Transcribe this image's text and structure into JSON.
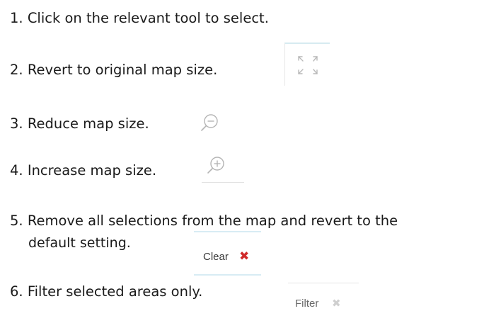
{
  "steps": [
    {
      "number": "1.",
      "text": "Click on the relevant tool to select."
    },
    {
      "number": "2.",
      "text": "Revert to original map size."
    },
    {
      "number": "3.",
      "text": "Reduce map size."
    },
    {
      "number": "4.",
      "text": "Increase map size."
    },
    {
      "number": "5.",
      "text_line1": "Remove all selections from the map and revert to the",
      "text_line2": "default setting."
    },
    {
      "number": "6.",
      "text": "Filter selected areas only."
    }
  ],
  "tools": {
    "revert_icon": "fullscreen-arrows-icon",
    "zoom_out_icon": "zoom-out-icon",
    "zoom_in_icon": "zoom-in-icon",
    "clear_label": "Clear",
    "clear_icon": "close-icon",
    "filter_label": "Filter",
    "filter_icon": "close-icon-disabled"
  },
  "colors": {
    "clear_x": "#d02a2a",
    "filter_x": "#cfcfcf",
    "accent_border": "#d8ecf4"
  }
}
